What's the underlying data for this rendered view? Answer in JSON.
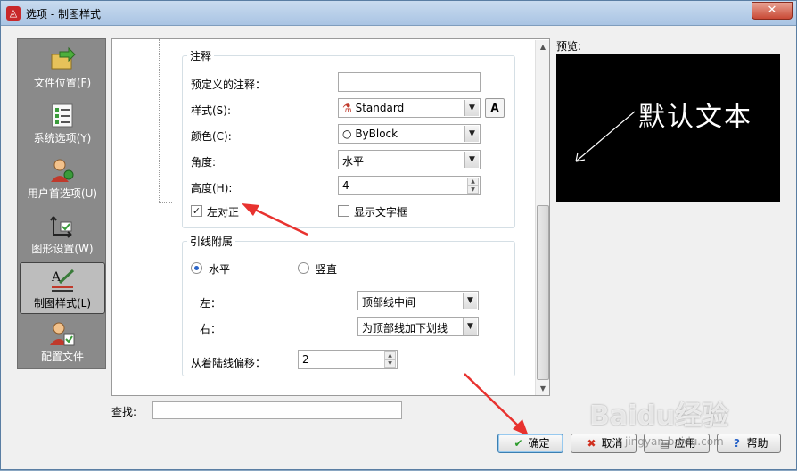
{
  "window": {
    "title": "选项 - 制图样式",
    "close_glyph": "✕"
  },
  "sidebar": {
    "items": [
      {
        "label": "文件位置(F)",
        "icon": "folder-arrow-icon"
      },
      {
        "label": "系统选项(Y)",
        "icon": "checklist-icon"
      },
      {
        "label": "用户首选项(U)",
        "icon": "user-gear-icon"
      },
      {
        "label": "图形设置(W)",
        "icon": "graphics-settings-icon"
      },
      {
        "label": "制图样式(L)",
        "icon": "drafting-style-icon",
        "selected": true
      },
      {
        "label": "配置文件",
        "icon": "profile-user-icon"
      }
    ]
  },
  "annotation_group": {
    "title": "注释",
    "predefined_label": "预定义的注释：",
    "predefined_value": "",
    "style_label": "样式(S):",
    "style_value": "Standard",
    "style_button": "A",
    "color_label": "颜色(C):",
    "color_value": "ByBlock",
    "angle_label": "角度:",
    "angle_value": "水平",
    "height_label": "高度(H):",
    "height_value": "4",
    "left_align_label": "左对正",
    "left_align_checked": true,
    "show_frame_label": "显示文字框",
    "show_frame_checked": false
  },
  "leader_group": {
    "title": "引线附属",
    "radio_horizontal": "水平",
    "radio_vertical": "竖直",
    "selected": "horizontal",
    "left_label": "左：",
    "left_value": "顶部线中间",
    "right_label": "右：",
    "right_value": "为顶部线加下划线",
    "offset_label": "从着陆线偏移：",
    "offset_value": "2"
  },
  "preview": {
    "label": "预览:",
    "text": "默认文本"
  },
  "search": {
    "label": "查找:",
    "value": ""
  },
  "buttons": {
    "ok": "确定",
    "cancel": "取消",
    "apply": "应用",
    "help": "帮助"
  },
  "watermark": {
    "logo": "Baidu经验",
    "url": "jingyan.baidu.com"
  },
  "colors": {
    "annotation_arrow": "#e8322f",
    "accent": "#2a64c8"
  }
}
